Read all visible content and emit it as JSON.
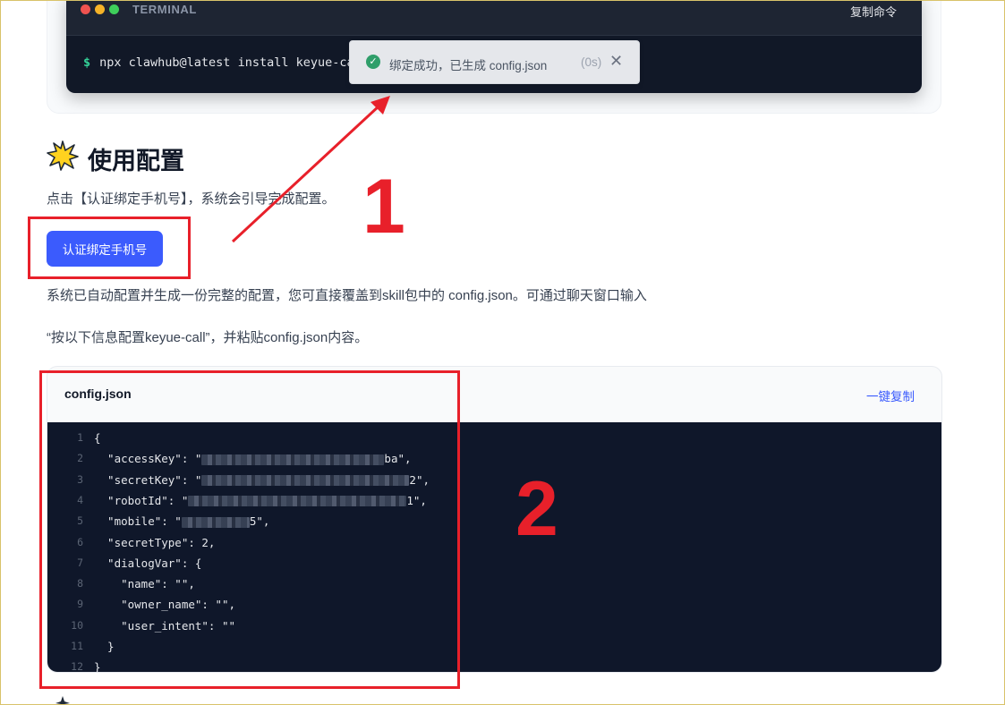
{
  "terminal": {
    "title": "TERMINAL",
    "copy_label": "复制命令",
    "prompt": "$",
    "command": "npx clawhub@latest install keyue-cal"
  },
  "toast": {
    "message": "绑定成功，已生成 config.json",
    "timer": "(0s)",
    "icon": "check-circle-icon",
    "close_icon": "close-icon"
  },
  "section": {
    "icon": "sparkle-star-icon",
    "title": "使用配置",
    "intro": "点击【认证绑定手机号】，系统会引导完成配置。",
    "button_label": "认证绑定手机号",
    "desc_line1": "系统已自动配置并生成一份完整的配置，您可直接覆盖到skill包中的 config.json。可通过聊天窗口输入",
    "desc_line2": "“按以下信息配置keyue-call”，并粘贴config.json内容。"
  },
  "code": {
    "filename": "config.json",
    "copy_label": "一键复制",
    "lines": [
      {
        "n": "1",
        "pre": "{",
        "post": ""
      },
      {
        "n": "2",
        "pre": "  \"accessKey\": \"",
        "post": "ba\","
      },
      {
        "n": "3",
        "pre": "  \"secretKey\": \"",
        "post": "2\","
      },
      {
        "n": "4",
        "pre": "  \"robotId\": \"",
        "post": "1\","
      },
      {
        "n": "5",
        "pre": "  \"mobile\": \"",
        "post": "5\","
      },
      {
        "n": "6",
        "pre": "  \"secretType\": 2,",
        "post": ""
      },
      {
        "n": "7",
        "pre": "  \"dialogVar\": {",
        "post": ""
      },
      {
        "n": "8",
        "pre": "    \"name\": \"\",",
        "post": ""
      },
      {
        "n": "9",
        "pre": "    \"owner_name\": \"\",",
        "post": ""
      },
      {
        "n": "10",
        "pre": "    \"user_intent\": \"\"",
        "post": ""
      },
      {
        "n": "11",
        "pre": "  }",
        "post": ""
      },
      {
        "n": "12",
        "pre": "}",
        "post": ""
      }
    ]
  },
  "annotations": {
    "label1": "1",
    "label2": "2",
    "color": "#e8202a"
  },
  "colors": {
    "accent": "#3b5bfd",
    "terminal_bg": "#111827",
    "code_bg": "#0f172a",
    "success": "#2f9e6a"
  }
}
